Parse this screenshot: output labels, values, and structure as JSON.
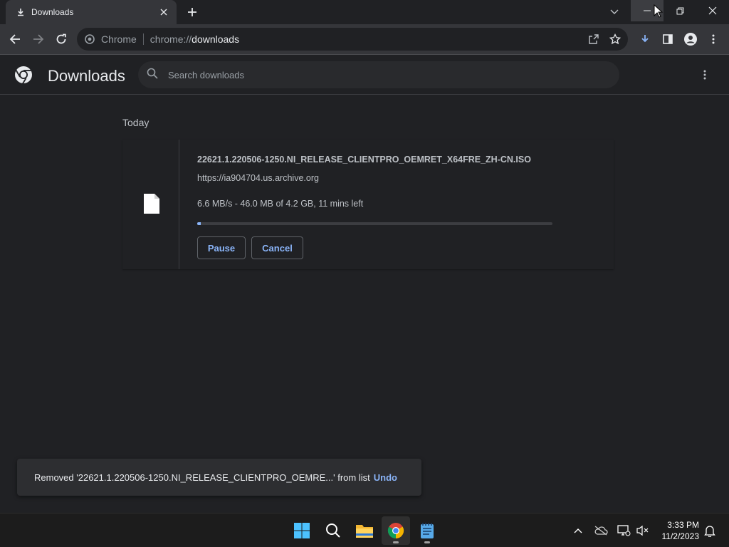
{
  "tab": {
    "title": "Downloads",
    "icon": "download-icon"
  },
  "toolbar": {
    "omnibox_site": "Chrome",
    "omnibox_scheme": "chrome://",
    "omnibox_host": "downloads"
  },
  "page": {
    "title": "Downloads",
    "search_placeholder": "Search downloads"
  },
  "downloads": {
    "day_label": "Today",
    "item": {
      "file_name": "22621.1.220506-1250.NI_RELEASE_CLIENTPRO_OEMRET_X64FRE_ZH-CN.ISO",
      "url": "https://ia904704.us.archive.org",
      "status": "6.6 MB/s - 46.0 MB of 4.2 GB, 11 mins left",
      "progress_fraction": 0.011,
      "pause_label": "Pause",
      "cancel_label": "Cancel"
    }
  },
  "snackbar": {
    "message": "Removed '22621.1.220506-1250.NI_RELEASE_CLIENTPRO_OEMRE...' from list",
    "undo_label": "Undo"
  },
  "taskbar": {
    "time": "3:33 PM",
    "date": "11/2/2023"
  },
  "colors": {
    "accent": "#8ab4f8",
    "background": "#202124",
    "toolbar": "#35363a"
  }
}
